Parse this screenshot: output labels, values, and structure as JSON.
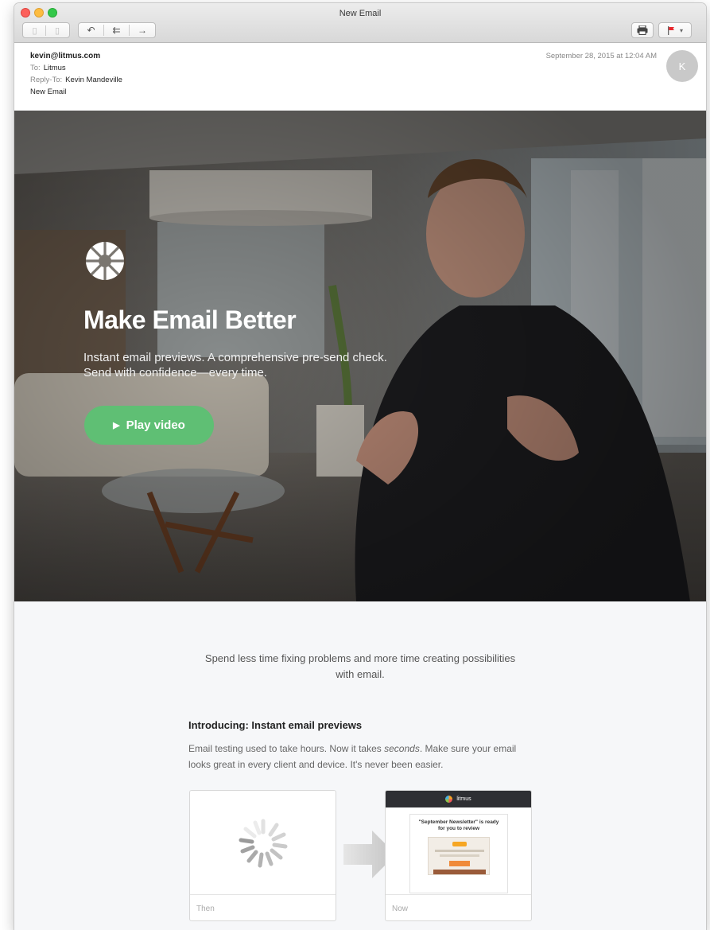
{
  "window": {
    "title": "New Email"
  },
  "toolbar": {
    "reply_icon": "reply-icon",
    "reply_all_icon": "reply-all-icon",
    "forward_icon": "forward-icon",
    "print_icon": "printer-icon",
    "flag_icon": "flag-icon",
    "flag_color": "#e8262b"
  },
  "email": {
    "from": "kevin@litmus.com",
    "to_label": "To:",
    "to": "Litmus",
    "reply_to_label": "Reply-To:",
    "reply_to": "Kevin Mandeville",
    "subject": "New Email",
    "date": "September 28, 2015 at 12:04 AM",
    "avatar_initial": "K"
  },
  "hero": {
    "title": "Make Email Better",
    "subtitle": "Instant email previews. A comprehensive pre-send check. Send with confidence—every time.",
    "play_label": "Play video",
    "play_color": "#5fbf74"
  },
  "content": {
    "lead": "Spend less time fixing problems and more time creating possibilities with email.",
    "intro_heading": "Introducing: Instant email previews",
    "intro_text_1": "Email testing used to take hours. Now it takes ",
    "intro_text_em": "seconds",
    "intro_text_2": ". Make sure your email looks great in every client and device. It's never been easier.",
    "then_label": "Then",
    "now_label": "Now",
    "mini_brand": "litmus",
    "mini_headline": "\"September Newsletter\" is ready for you to review"
  }
}
